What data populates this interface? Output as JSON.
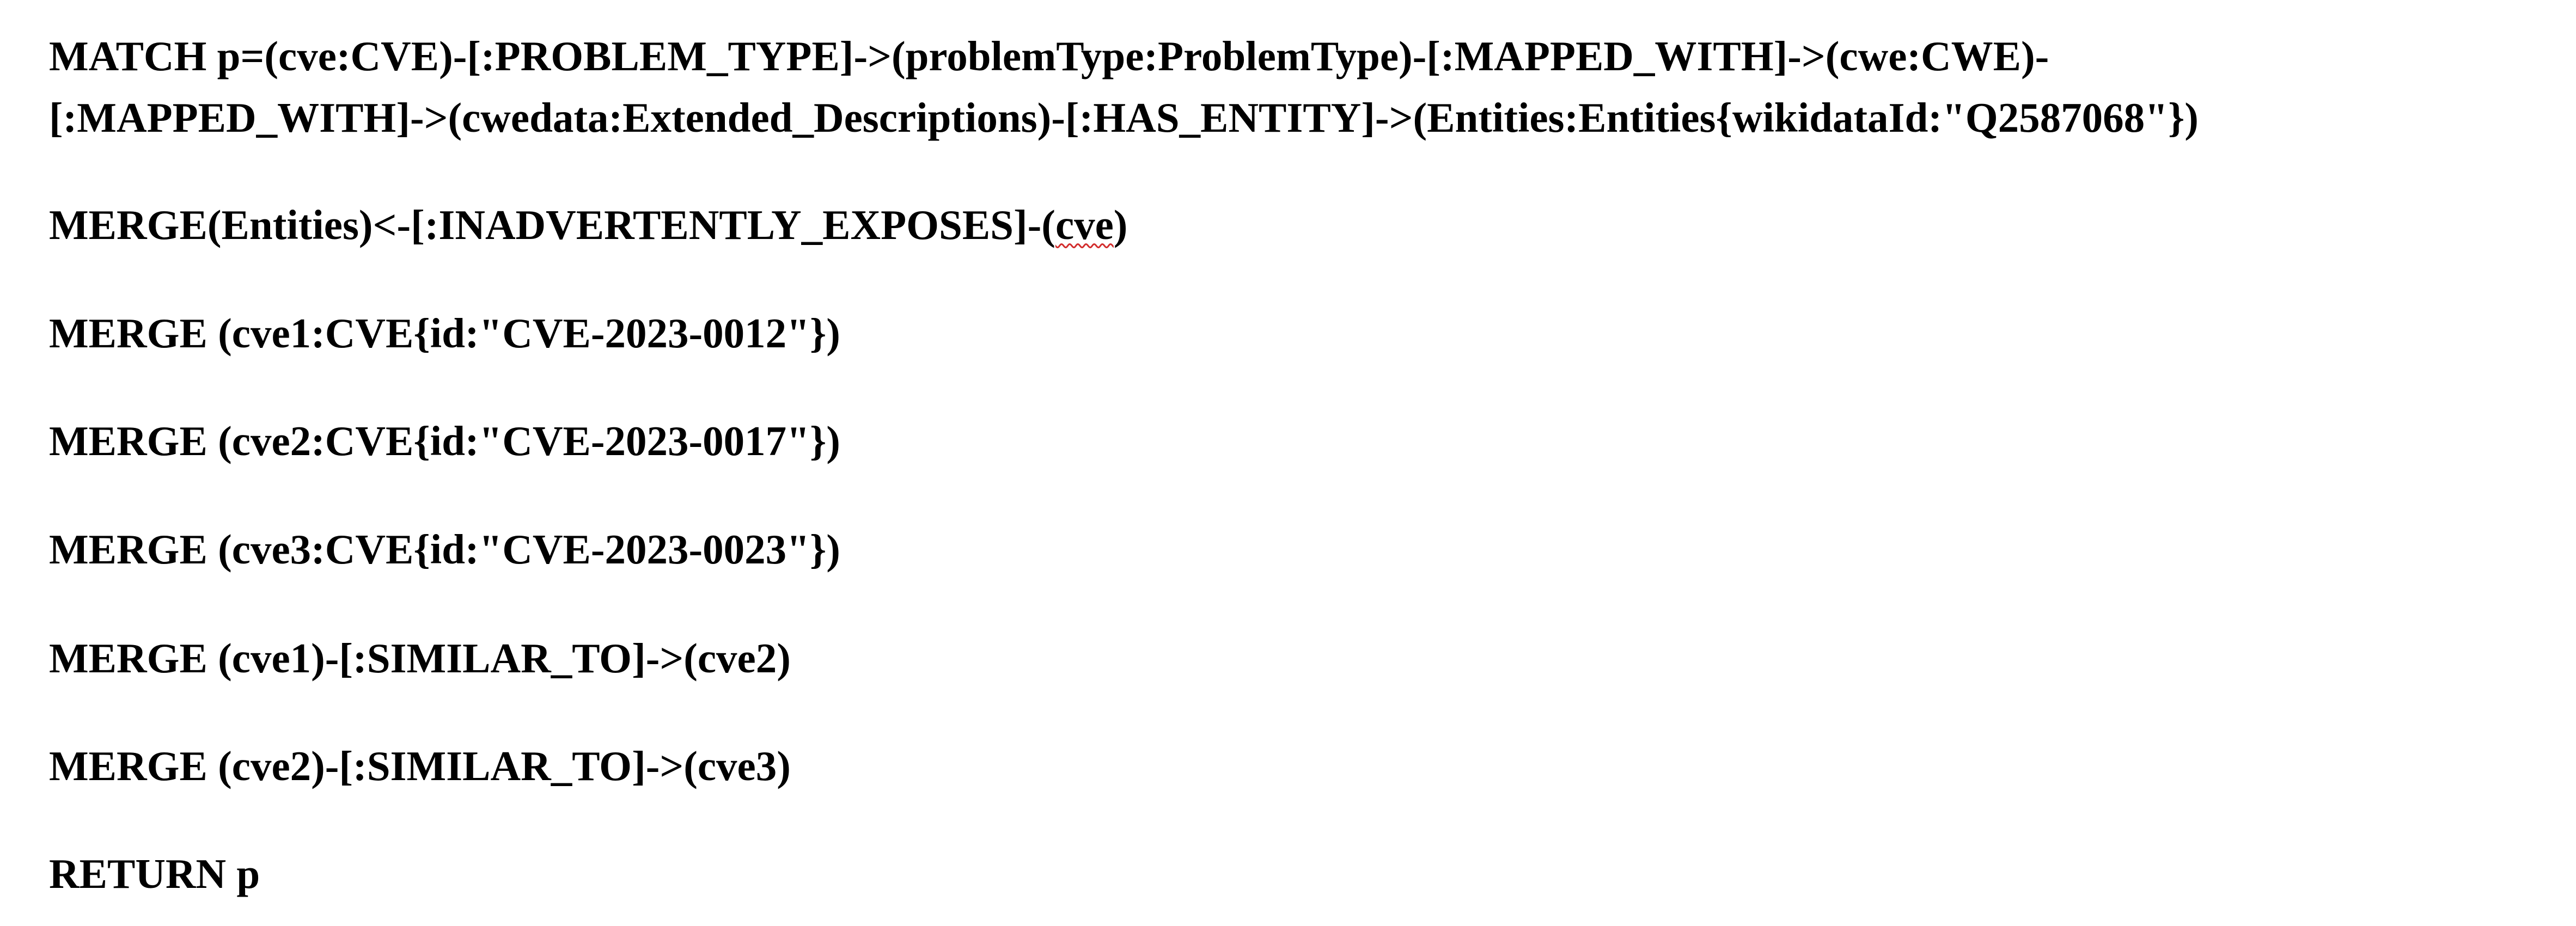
{
  "document": {
    "lines": [
      "MATCH p=(cve:CVE)-[:PROBLEM_TYPE]->(problemType:ProblemType)-[:MAPPED_WITH]->(cwe:CWE)-",
      "[:MAPPED_WITH]->(cwedata:Extended_Descriptions)-[:HAS_ENTITY]->(Entities:Entities{wikidataId:\"Q2587068\"})",
      {
        "prefix": "MERGE(Entities)<-[:INADVERTENTLY_EXPOSES]-(",
        "misspelled_word": "cve",
        "suffix": ")"
      },
      "MERGE (cve1:CVE{id:\"CVE-2023-0012\"})",
      "MERGE (cve2:CVE{id:\"CVE-2023-0017\"})",
      "MERGE (cve3:CVE{id:\"CVE-2023-0023\"})",
      "MERGE (cve1)-[:SIMILAR_TO]->(cve2)",
      "MERGE (cve2)-[:SIMILAR_TO]->(cve3)",
      "RETURN p"
    ],
    "spellcheck_underline_color": "#d22c2c",
    "text_color": "#000000",
    "background_color": "#ffffff"
  }
}
